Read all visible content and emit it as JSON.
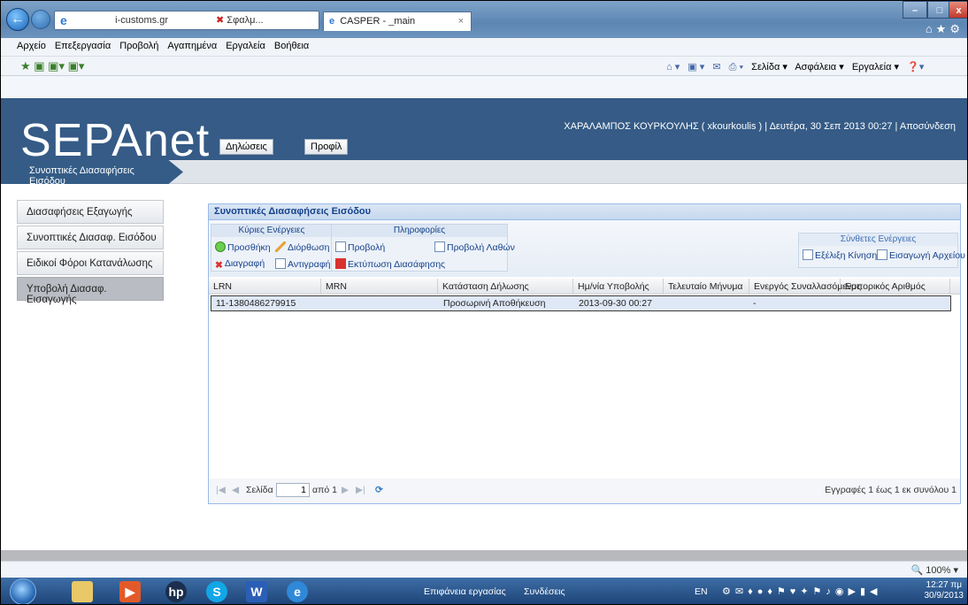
{
  "browser": {
    "tab_small_url": "i-customs.gr",
    "tab_small_label": "Σφαλμ...",
    "tab_title": "CASPER - _main",
    "menu": [
      "Αρχείο",
      "Επεξεργασία",
      "Προβολή",
      "Αγαπημένα",
      "Εργαλεία",
      "Βοήθεια"
    ],
    "commandbar": [
      "Σελίδα ▾",
      "Ασφάλεια ▾",
      "Εργαλεία ▾"
    ],
    "zoom": "100%"
  },
  "app": {
    "logo": "SEPAnet",
    "menu_declarations": "Δηλώσεις",
    "menu_profile": "Προφίλ",
    "user_line": "ΧΑΡΑΛΑΜΠΟΣ ΚΟΥΡΚΟΥΛΗΣ ( xkourkoulis ) | Δευτέρα, 30 Σεπ 2013 00:27 | Αποσύνδεση",
    "breadcrumb": "Συνοπτικές Διασαφήσεις Εισόδου"
  },
  "sidebar": {
    "items": [
      {
        "label": "Διασαφήσεις Εξαγωγής"
      },
      {
        "label": "Συνοπτικές Διασαφ. Εισόδου"
      },
      {
        "label": "Ειδικοί Φόροι Κατανάλωσης"
      },
      {
        "label": "Υποβολή Διασαφ. Εισαγωγής"
      }
    ]
  },
  "panel": {
    "title": "Συνοπτικές Διασαφήσεις Εισόδου",
    "group_main": "Κύριες Ενέργειες",
    "group_info": "Πληροφορίες",
    "group_composite": "Σύνθετες Ενέργειες",
    "btn_add": "Προσθήκη",
    "btn_edit": "Διόρθωση",
    "btn_delete": "Διαγραφή",
    "btn_copy": "Αντιγραφή",
    "btn_view": "Προβολή",
    "btn_view_errors": "Προβολή Λαθών",
    "btn_print": "Εκτύπωση Διασάφησης",
    "btn_movement": "Εξέλιξη Κίνησης",
    "btn_import_file": "Εισαγωγή Αρχείου"
  },
  "grid": {
    "columns": [
      "LRN",
      "MRN",
      "Κατάσταση Δήλωσης",
      "Ημ/νία Υποβολής",
      "Τελευταίο Μήνυμα",
      "Ενεργός Συναλλασόμενος",
      "Εμπορικός Αριθμός"
    ],
    "rows": [
      {
        "lrn": "11-1380486279915",
        "mrn": "",
        "status": "Προσωρινή Αποθήκευση",
        "date": "2013-09-30 00:27",
        "last_msg": "",
        "trader": "-",
        "commercial": ""
      }
    ]
  },
  "pager": {
    "page_label": "Σελίδα",
    "page_value": "1",
    "of_label": "από 1",
    "records": "Εγγραφές 1 έως 1 εκ συνόλου 1"
  },
  "taskbar": {
    "desktop": "Επιφάνεια εργασίας",
    "links": "Συνδέσεις",
    "lang": "EN",
    "time": "12:27 πμ",
    "date": "30/9/2013"
  }
}
